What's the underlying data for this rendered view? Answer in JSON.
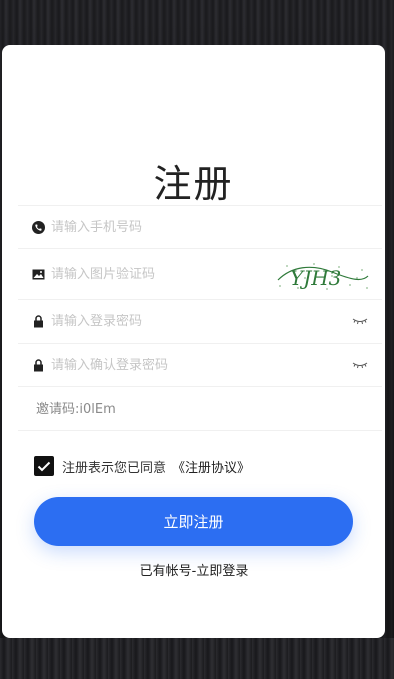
{
  "title": "注册",
  "fields": {
    "phone_placeholder": "请输入手机号码",
    "image_code_placeholder": "请输入图片验证码",
    "password_placeholder": "请输入登录密码",
    "confirm_password_placeholder": "请输入确认登录密码"
  },
  "captcha_text": "YJH3",
  "invite_code": "邀请码:i0lEm",
  "agreement": {
    "checked": true,
    "text": "注册表示您已同意",
    "link": "《注册协议》"
  },
  "submit_label": "立即注册",
  "login_link": "已有帐号-立即登录",
  "colors": {
    "primary": "#2c6ef2",
    "background": "#141416",
    "card": "#ffffff"
  }
}
